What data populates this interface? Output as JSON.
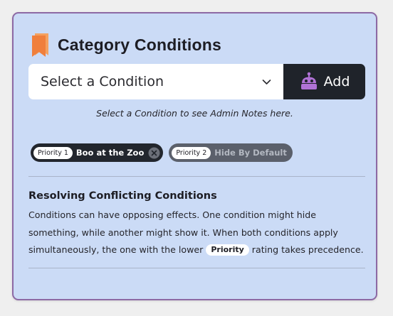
{
  "card": {
    "title": "Category Conditions",
    "icon": "bookmark-icon",
    "accent": "#f07f3c"
  },
  "select": {
    "value": "Select a Condition",
    "icon": "chevron-down-icon"
  },
  "add_button": {
    "label": "Add",
    "icon": "robot-icon",
    "icon_color": "#b072d6"
  },
  "hint": "Select a Condition to see Admin Notes here.",
  "chips": [
    {
      "priority": "Priority 1",
      "label": "Boo at the Zoo",
      "removable": true,
      "state": "active"
    },
    {
      "priority": "Priority 2",
      "label": "Hide By Default",
      "removable": false,
      "state": "muted"
    }
  ],
  "info": {
    "title": "Resolving Conflicting Conditions",
    "body_before": "Conditions can have opposing effects. One condition might hide something, while another might show it. When both conditions apply simultaneously, the one with the lower",
    "badge": "Priority",
    "body_after": "rating takes precedence."
  },
  "colors": {
    "card_bg": "#cbdbf6",
    "card_border": "#8d69a4",
    "dark": "#1f232a"
  }
}
